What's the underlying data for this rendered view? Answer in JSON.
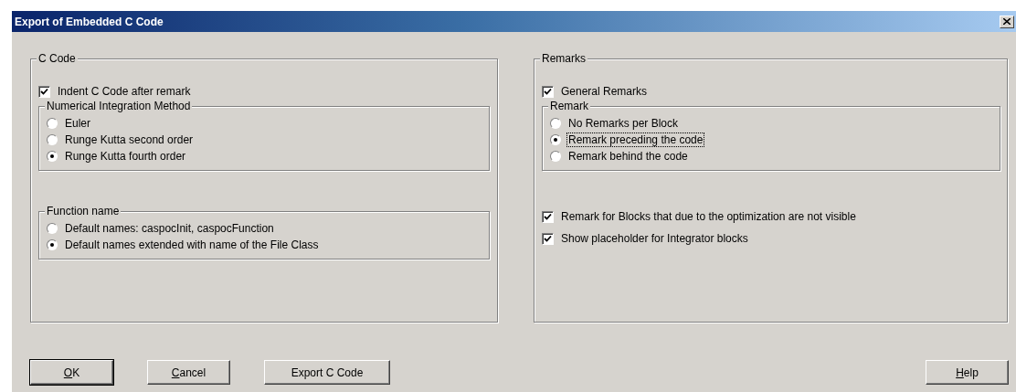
{
  "window": {
    "title": "Export of Embedded C Code"
  },
  "panels": [
    {
      "title": "C Code",
      "items": [
        {
          "kind": "checkbox",
          "label": "Indent C Code after remark",
          "checked": true
        },
        {
          "kind": "group",
          "title": "Numerical Integration Method",
          "options": [
            {
              "label": "Euler",
              "selected": false,
              "focused": false
            },
            {
              "label": "Runge Kutta second order",
              "selected": false,
              "focused": false
            },
            {
              "label": "Runge Kutta fourth order",
              "selected": true,
              "focused": false
            }
          ]
        },
        {
          "kind": "group",
          "title": "Function name",
          "options": [
            {
              "label": "Default names: caspocInit, caspocFunction",
              "selected": false,
              "focused": false
            },
            {
              "label": "Default names extended with name of the File Class",
              "selected": true,
              "focused": false
            }
          ]
        }
      ]
    },
    {
      "title": "Remarks",
      "items": [
        {
          "kind": "checkbox",
          "label": "General Remarks",
          "checked": true
        },
        {
          "kind": "group",
          "title": "Remark",
          "options": [
            {
              "label": "No Remarks per Block",
              "selected": false,
              "focused": false
            },
            {
              "label": "Remark preceding the code",
              "selected": true,
              "focused": true
            },
            {
              "label": "Remark behind the code",
              "selected": false,
              "focused": false
            }
          ]
        },
        {
          "kind": "checkbox",
          "label": "Remark for Blocks that due to the optimization are not visible",
          "checked": true
        },
        {
          "kind": "checkbox",
          "label": "Show placeholder for Integrator blocks",
          "checked": true
        }
      ]
    }
  ],
  "buttons": [
    {
      "label": "OK",
      "first_letter_underlined": true,
      "default": true
    },
    {
      "label": "Cancel",
      "first_letter_underlined": true,
      "default": false
    },
    {
      "label": "Export C Code",
      "first_letter_underlined": false,
      "default": false
    }
  ],
  "right_buttons": [
    {
      "label": "Help",
      "first_letter_underlined": true,
      "default": false
    }
  ]
}
